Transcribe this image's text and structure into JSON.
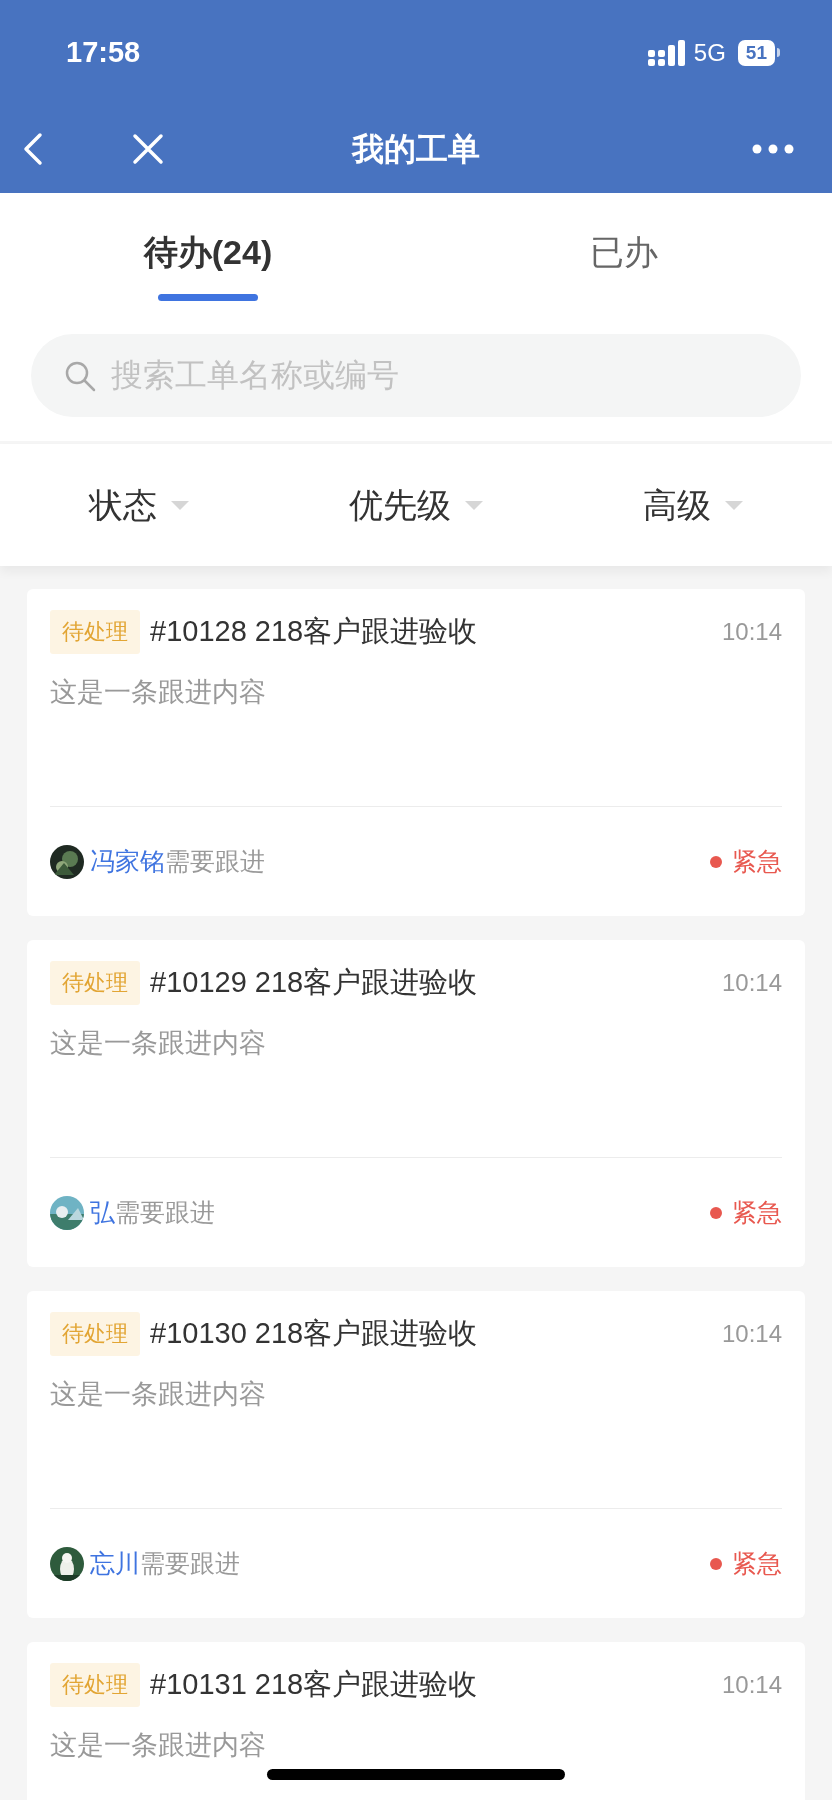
{
  "status_bar": {
    "time": "17:58",
    "network": "5G",
    "battery": "51"
  },
  "nav": {
    "title": "我的工单"
  },
  "tabs": [
    {
      "label": "待办(24)",
      "selected": true
    },
    {
      "label": "已办",
      "selected": false
    }
  ],
  "search": {
    "placeholder": "搜索工单名称或编号"
  },
  "filters": [
    "状态",
    "优先级",
    "高级"
  ],
  "cards": [
    {
      "status": "待处理",
      "title": "#10128 218客户跟进验收",
      "time": "10:14",
      "content": "这是一条跟进内容",
      "assignee": "冯家铭",
      "action": "需要跟进",
      "priority": {
        "label": "紧急",
        "color": "#e8584f"
      }
    },
    {
      "status": "待处理",
      "title": "#10129 218客户跟进验收",
      "time": "10:14",
      "content": "这是一条跟进内容",
      "assignee": "弘",
      "action": "需要跟进",
      "priority": {
        "label": "紧急",
        "color": "#e8584f"
      }
    },
    {
      "status": "待处理",
      "title": "#10130 218客户跟进验收",
      "time": "10:14",
      "content": "这是一条跟进内容",
      "assignee": "忘川",
      "action": "需要跟进",
      "priority": {
        "label": "紧急",
        "color": "#e8584f"
      }
    },
    {
      "status": "待处理",
      "title": "#10131 218客户跟进验收",
      "time": "10:14",
      "content": "这是一条跟进内容"
    }
  ]
}
